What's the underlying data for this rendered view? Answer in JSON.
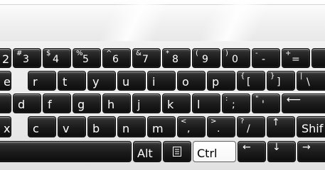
{
  "keyboard": {
    "number_row": [
      {
        "main": "2",
        "shift": ""
      },
      {
        "main": "3",
        "shift": "#"
      },
      {
        "main": "4",
        "shift": "$"
      },
      {
        "main": "5",
        "shift": "%"
      },
      {
        "main": "6",
        "shift": "^"
      },
      {
        "main": "7",
        "shift": "&"
      },
      {
        "main": "8",
        "shift": "*"
      },
      {
        "main": "9",
        "shift": "("
      },
      {
        "main": "0",
        "shift": ")"
      },
      {
        "main": "-",
        "shift": "-"
      },
      {
        "main": "=",
        "shift": "+"
      }
    ],
    "top_row": [
      {
        "main": "e",
        "shift": ""
      },
      {
        "main": "r",
        "shift": ""
      },
      {
        "main": "t",
        "shift": ""
      },
      {
        "main": "y",
        "shift": ""
      },
      {
        "main": "u",
        "shift": ""
      },
      {
        "main": "i",
        "shift": ""
      },
      {
        "main": "o",
        "shift": ""
      },
      {
        "main": "p",
        "shift": ""
      },
      {
        "main": "[",
        "shift": "{"
      },
      {
        "main": "]",
        "shift": "}"
      },
      {
        "main": "\\",
        "shift": "|"
      }
    ],
    "home_row": [
      {
        "main": "d",
        "shift": ""
      },
      {
        "main": "f",
        "shift": ""
      },
      {
        "main": "g",
        "shift": ""
      },
      {
        "main": "h",
        "shift": ""
      },
      {
        "main": "j",
        "shift": ""
      },
      {
        "main": "k",
        "shift": ""
      },
      {
        "main": "l",
        "shift": ""
      },
      {
        "main": ";",
        "shift": ":"
      },
      {
        "main": "'",
        "shift": "\""
      }
    ],
    "bottom_row": [
      {
        "main": "x",
        "shift": ""
      },
      {
        "main": "c",
        "shift": ""
      },
      {
        "main": "v",
        "shift": ""
      },
      {
        "main": "b",
        "shift": ""
      },
      {
        "main": "n",
        "shift": ""
      },
      {
        "main": "m",
        "shift": ""
      },
      {
        "main": ",",
        "shift": "<"
      },
      {
        "main": ".",
        "shift": ">"
      },
      {
        "main": "/",
        "shift": "?"
      }
    ],
    "shift_label": "Shif",
    "alt_label": "Alt",
    "ctrl_label": "Ctrl",
    "enter_glyph": "⟵",
    "up_arrow_glyph": "↑",
    "left_arrow_glyph": "←",
    "down_arrow_glyph": "↓",
    "right_arrow_glyph": "→",
    "menu_icon": "menu-icon",
    "active_key": "Ctrl",
    "colors": {
      "key_face": "#1a1a1a",
      "key_text": "#ffffff",
      "active_key_face": "#ffffff",
      "active_key_text": "#000000",
      "background": "#ebebeb"
    }
  }
}
